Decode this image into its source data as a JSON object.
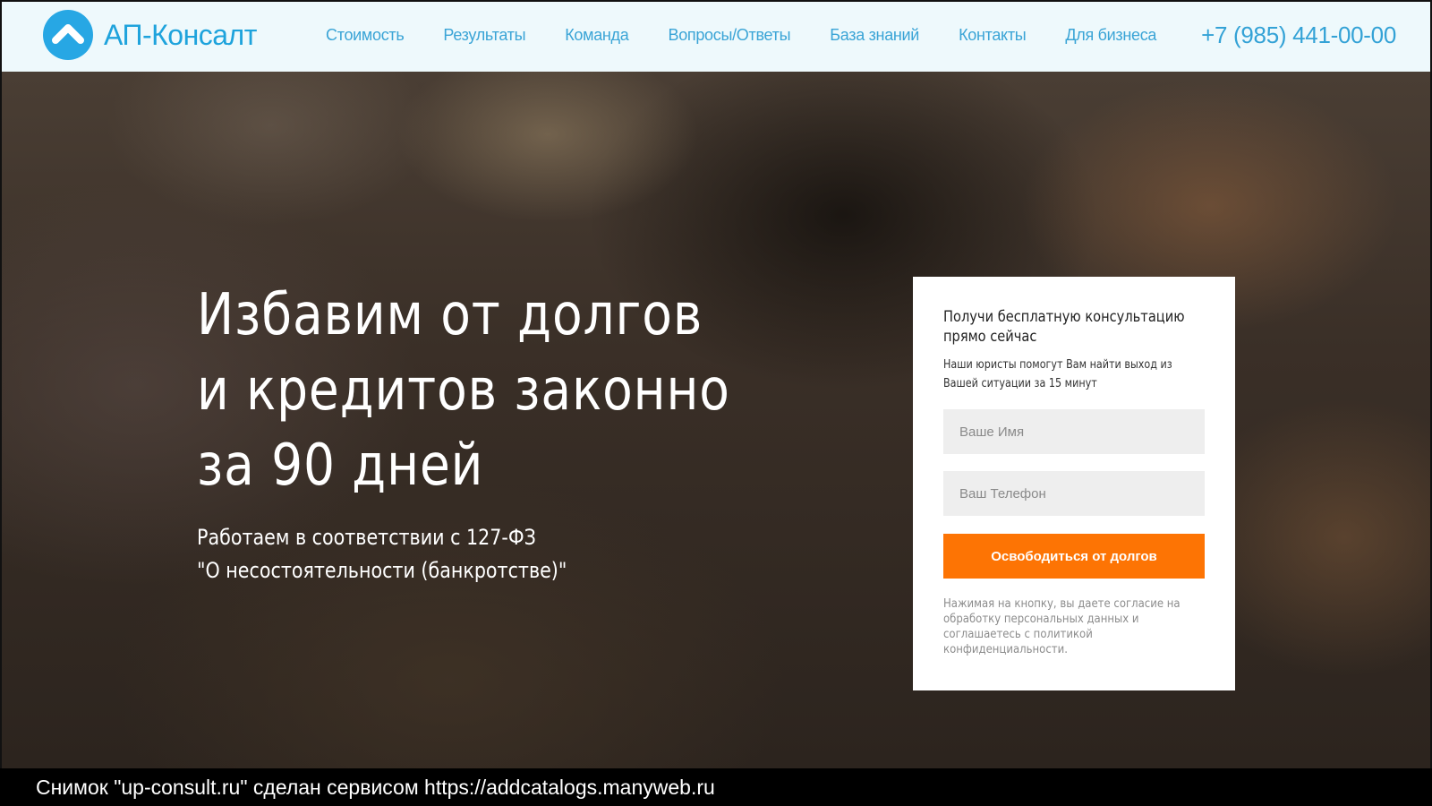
{
  "brand": {
    "name": "АП-Консалт"
  },
  "nav": {
    "items": [
      {
        "label": "Стоимость"
      },
      {
        "label": "Результаты"
      },
      {
        "label": "Команда"
      },
      {
        "label": "Вопросы/Ответы"
      },
      {
        "label": "База знаний"
      },
      {
        "label": "Контакты"
      },
      {
        "label": "Для бизнеса"
      }
    ]
  },
  "header": {
    "phone": "+7 (985) 441-00-00"
  },
  "hero": {
    "headline": "Избавим от долгов и кредитов законно за 90 дней",
    "subline_1": "Работаем в соответствии с 127-ФЗ",
    "subline_2": "\"О несостоятельности (банкротстве)\""
  },
  "form": {
    "title": "Получи бесплатную консультацию прямо сейчас",
    "description": "Наши юристы помогут Вам найти выход из Вашей ситуации за 15 минут",
    "name_placeholder": "Ваше Имя",
    "phone_placeholder": "Ваш Телефон",
    "submit_label": "Освободиться от долгов",
    "consent": "Нажимая на кнопку, вы даете согласие на обработку персональных данных и соглашаетесь с политикой конфиденциальности."
  },
  "caption": {
    "text": "Снимок \"up-consult.ru\" сделан сервисом https://addcatalogs.manyweb.ru"
  },
  "colors": {
    "accent_blue": "#27a7e4",
    "cta_orange": "#fd7404",
    "header_bg": "#eef9fc"
  },
  "icons": {
    "logo": "chevron-up-circle-icon"
  }
}
